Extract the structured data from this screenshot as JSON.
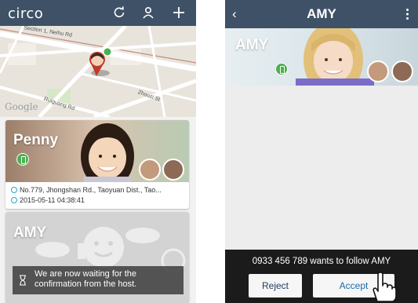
{
  "left_phone": {
    "app_logo": "circo",
    "header_icons": [
      "refresh-icon",
      "person-icon",
      "plus-icon"
    ],
    "map": {
      "labels": [
        "Section 1, Neihu Rd",
        "Ruiguang Rd",
        "Zhouzi St"
      ],
      "attribution": "Google"
    },
    "cards": [
      {
        "name": "Penny",
        "address": "No.779, Jhongshan Rd., Taoyuan Dist., Tao...",
        "timestamp": "2015-05-11 04:38:41"
      },
      {
        "name": "AMY"
      }
    ],
    "toast": "We are now waiting for the confirmation from the host."
  },
  "right_phone": {
    "title": "AMY",
    "banner_name": "AMY",
    "follow_request": "0933 456 789 wants to follow AMY",
    "reject_label": "Reject",
    "accept_label": "Accept"
  },
  "colors": {
    "header": "#3f5166",
    "accent_green": "#4caf50",
    "button_text": "#1a6aa8",
    "bottom_bar": "#1b1b1b"
  }
}
